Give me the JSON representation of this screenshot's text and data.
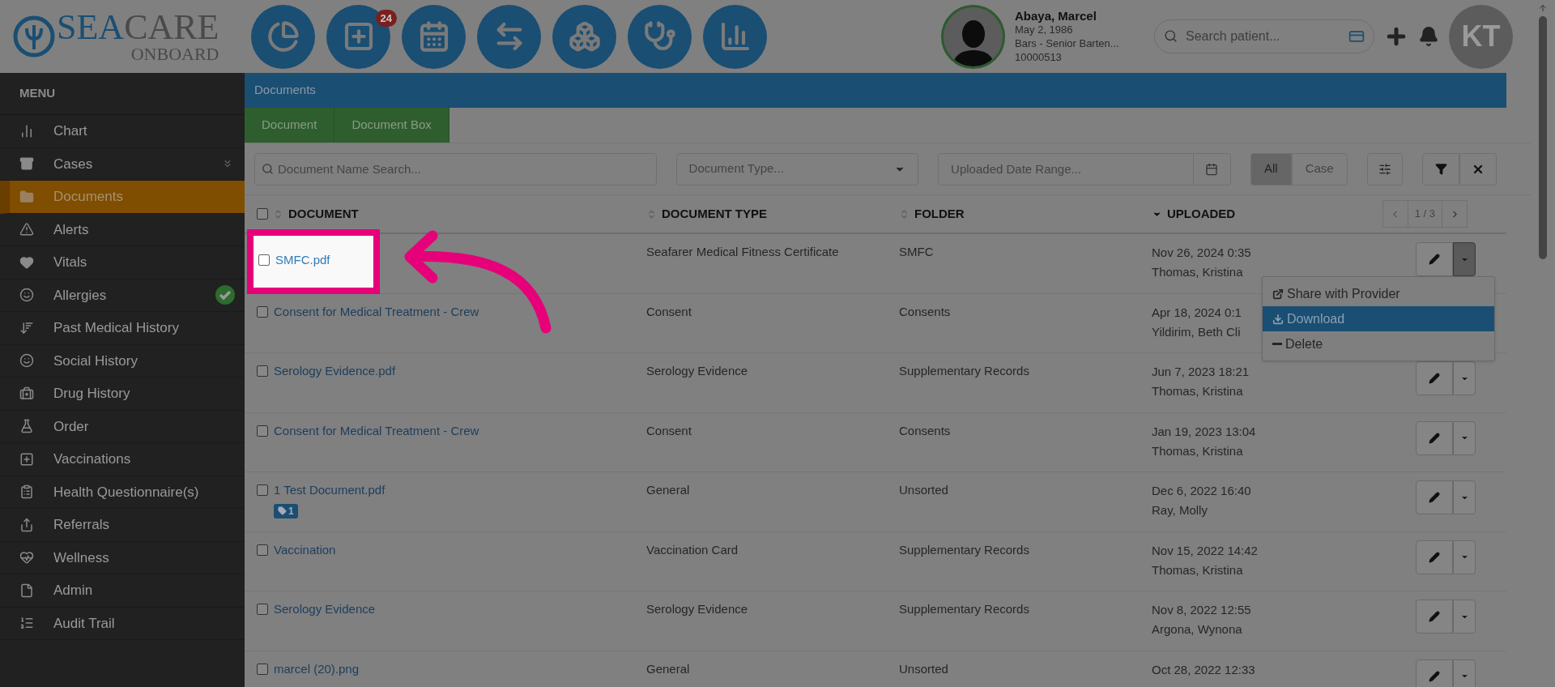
{
  "logo": {
    "main_dark": "SEA",
    "main_light": "CARE",
    "sub": "ONBOARD"
  },
  "nav_buttons": [
    {
      "kind": "chart"
    },
    {
      "kind": "new",
      "badge": "24"
    },
    {
      "kind": "calendar"
    },
    {
      "kind": "transfer"
    },
    {
      "kind": "boxes"
    },
    {
      "kind": "medical"
    },
    {
      "kind": "reports"
    }
  ],
  "patient": {
    "name": "Abaya, Marcel",
    "dob": "May 2, 1986",
    "role": "Bars - Senior Barten...",
    "id": "10000513"
  },
  "patient_search": {
    "placeholder": "Search patient..."
  },
  "user": {
    "initials": "KT"
  },
  "sidebar": {
    "title": "MENU",
    "items": [
      {
        "label": "Chart",
        "selected": false,
        "expandable": false,
        "verified": false
      },
      {
        "label": "Cases",
        "selected": false,
        "expandable": true,
        "verified": false
      },
      {
        "label": "Documents",
        "selected": true,
        "expandable": false,
        "verified": false
      },
      {
        "label": "Alerts",
        "selected": false,
        "expandable": false,
        "verified": false
      },
      {
        "label": "Vitals",
        "selected": false,
        "expandable": false,
        "verified": false
      },
      {
        "label": "Allergies",
        "selected": false,
        "expandable": false,
        "verified": true
      },
      {
        "label": "Past Medical History",
        "selected": false,
        "expandable": false,
        "verified": false
      },
      {
        "label": "Social History",
        "selected": false,
        "expandable": false,
        "verified": false
      },
      {
        "label": "Drug History",
        "selected": false,
        "expandable": false,
        "verified": false
      },
      {
        "label": "Order",
        "selected": false,
        "expandable": false,
        "verified": false
      },
      {
        "label": "Vaccinations",
        "selected": false,
        "expandable": false,
        "verified": false
      },
      {
        "label": "Health Questionnaire(s)",
        "selected": false,
        "expandable": false,
        "verified": false
      },
      {
        "label": "Referrals",
        "selected": false,
        "expandable": false,
        "verified": false
      },
      {
        "label": "Wellness",
        "selected": false,
        "expandable": false,
        "verified": false
      },
      {
        "label": "Admin",
        "selected": false,
        "expandable": false,
        "verified": false
      },
      {
        "label": "Audit Trail",
        "selected": false,
        "expandable": false,
        "verified": false
      }
    ]
  },
  "page_title": "Documents",
  "tabs": [
    {
      "label": "Document"
    },
    {
      "label": "Document Box"
    }
  ],
  "filters": {
    "search_placeholder": "Document Name Search...",
    "type_placeholder": "Document Type...",
    "date_placeholder": "Uploaded Date Range...",
    "scope": [
      {
        "label": "All",
        "selected": true
      },
      {
        "label": "Case",
        "selected": false
      }
    ]
  },
  "table": {
    "columns": [
      "DOCUMENT",
      "DOCUMENT TYPE",
      "FOLDER",
      "UPLOADED"
    ],
    "page": "1 / 3",
    "all_checked": false,
    "rows": [
      {
        "document": "SMFC.pdf",
        "type": "Seafarer Medical Fitness Certificate",
        "folder": "SMFC",
        "date": "Nov 26, 2024 0:35",
        "user": "Thomas, Kristina",
        "spotlight": true,
        "menu_open": true,
        "checked": false
      },
      {
        "document": "Consent for Medical Treatment - Crew",
        "type": "Consent",
        "folder": "Consents",
        "date": "Apr 18, 2024 0:1",
        "user": "Yildirim, Beth Cli",
        "spotlight": false,
        "menu_open": false,
        "checked": false
      },
      {
        "document": "Serology Evidence.pdf",
        "type": "Serology Evidence",
        "folder": "Supplementary Records",
        "date": "Jun 7, 2023 18:21",
        "user": "Thomas, Kristina",
        "spotlight": false,
        "menu_open": false,
        "checked": false
      },
      {
        "document": "Consent for Medical Treatment - Crew",
        "type": "Consent",
        "folder": "Consents",
        "date": "Jan 19, 2023 13:04",
        "user": "Thomas, Kristina",
        "spotlight": false,
        "menu_open": false,
        "checked": false
      },
      {
        "document": "1 Test Document.pdf",
        "tag": "1",
        "type": "General",
        "folder": "Unsorted",
        "date": "Dec 6, 2022 16:40",
        "user": "Ray, Molly",
        "spotlight": false,
        "menu_open": false,
        "checked": false
      },
      {
        "document": "Vaccination",
        "type": "Vaccination Card",
        "folder": "Supplementary Records",
        "date": "Nov 15, 2022 14:42",
        "user": "Thomas, Kristina",
        "spotlight": false,
        "menu_open": false,
        "checked": false
      },
      {
        "document": "Serology Evidence",
        "type": "Serology Evidence",
        "folder": "Supplementary Records",
        "date": "Nov 8, 2022 12:55",
        "user": "Argona, Wynona",
        "spotlight": false,
        "menu_open": false,
        "checked": false
      },
      {
        "document": "marcel (20).png",
        "type": "General",
        "folder": "Unsorted",
        "date": "Oct 28, 2022 12:33",
        "spotlight": false,
        "menu_open": false,
        "checked": false
      }
    ]
  },
  "row_menu": [
    {
      "label": "Share with Provider",
      "selected": false
    },
    {
      "label": "Download",
      "selected": true
    },
    {
      "label": "Delete",
      "selected": false
    }
  ]
}
